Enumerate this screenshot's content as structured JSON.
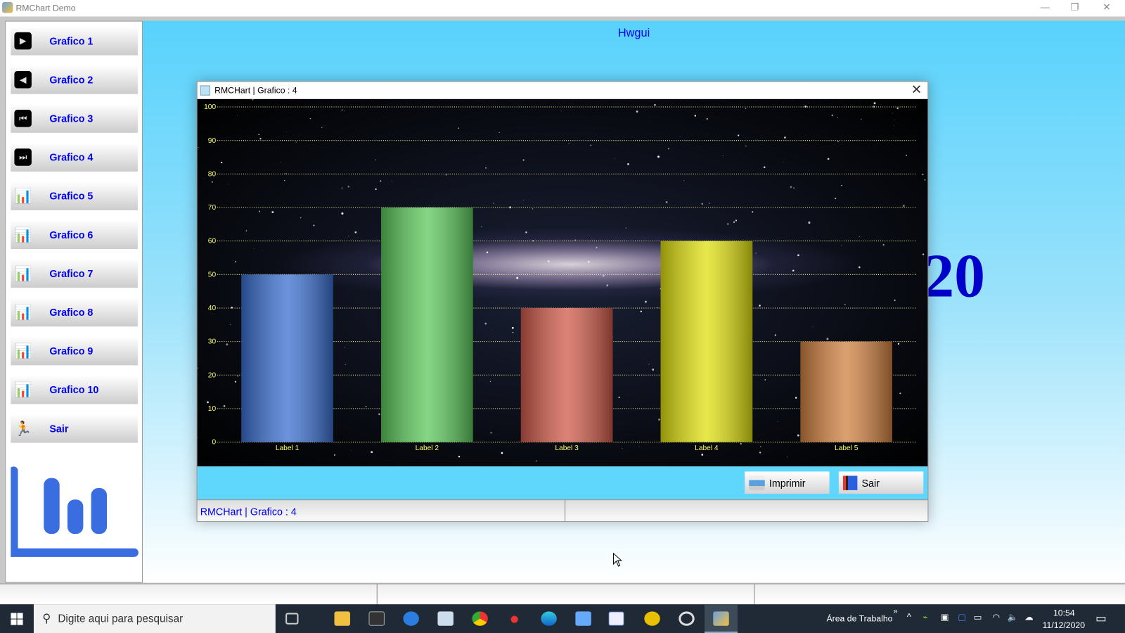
{
  "window": {
    "title": "RMChart Demo",
    "controls": [
      "—",
      "❐",
      "✕"
    ]
  },
  "sidebar": {
    "items": [
      {
        "label": "Grafico 1",
        "icon": "play-icon",
        "glyph": "▶"
      },
      {
        "label": "Grafico 2",
        "icon": "back-icon",
        "glyph": "◀"
      },
      {
        "label": "Grafico 3",
        "icon": "first-icon",
        "glyph": "⏮"
      },
      {
        "label": "Grafico 4",
        "icon": "last-icon",
        "glyph": "⏭"
      },
      {
        "label": "Grafico 5",
        "icon": "bar-chart-icon",
        "glyph": "📊"
      },
      {
        "label": "Grafico 6",
        "icon": "bar-chart-icon",
        "glyph": "📊"
      },
      {
        "label": "Grafico 7",
        "icon": "bar-chart-icon",
        "glyph": "📊"
      },
      {
        "label": "Grafico 8",
        "icon": "bar-chart-icon",
        "glyph": "📊"
      },
      {
        "label": "Grafico 9",
        "icon": "bar-chart-icon",
        "glyph": "📊"
      },
      {
        "label": "Grafico 10",
        "icon": "bar-chart-icon",
        "glyph": "📊"
      },
      {
        "label": "Sair",
        "icon": "exit-icon",
        "glyph": "🏃"
      }
    ]
  },
  "main": {
    "heading": "Hwgui",
    "big_text": "20"
  },
  "dialog": {
    "title": "RMCHart | Grafico : 4",
    "close": "✕",
    "print_label": "Imprimir",
    "exit_label": "Sair",
    "status": "RMCHart | Grafico : 4"
  },
  "chart_data": {
    "type": "bar",
    "categories": [
      "Label 1",
      "Label 2",
      "Label 3",
      "Label 4",
      "Label 5"
    ],
    "values": [
      50,
      70,
      40,
      60,
      30
    ],
    "colors": [
      "#3a6fd0",
      "#5cc85c",
      "#d05a4a",
      "#e0e010",
      "#d08040"
    ],
    "ylim": [
      0,
      100
    ],
    "yticks": [
      0,
      10,
      20,
      30,
      40,
      50,
      60,
      70,
      80,
      90,
      100
    ],
    "grid": true,
    "label_color": "#ffff66"
  },
  "taskbar": {
    "search_placeholder": "Digite aqui para pesquisar",
    "desktop_label": "Área de Trabalho",
    "time": "10:54",
    "date": "11/12/2020"
  }
}
